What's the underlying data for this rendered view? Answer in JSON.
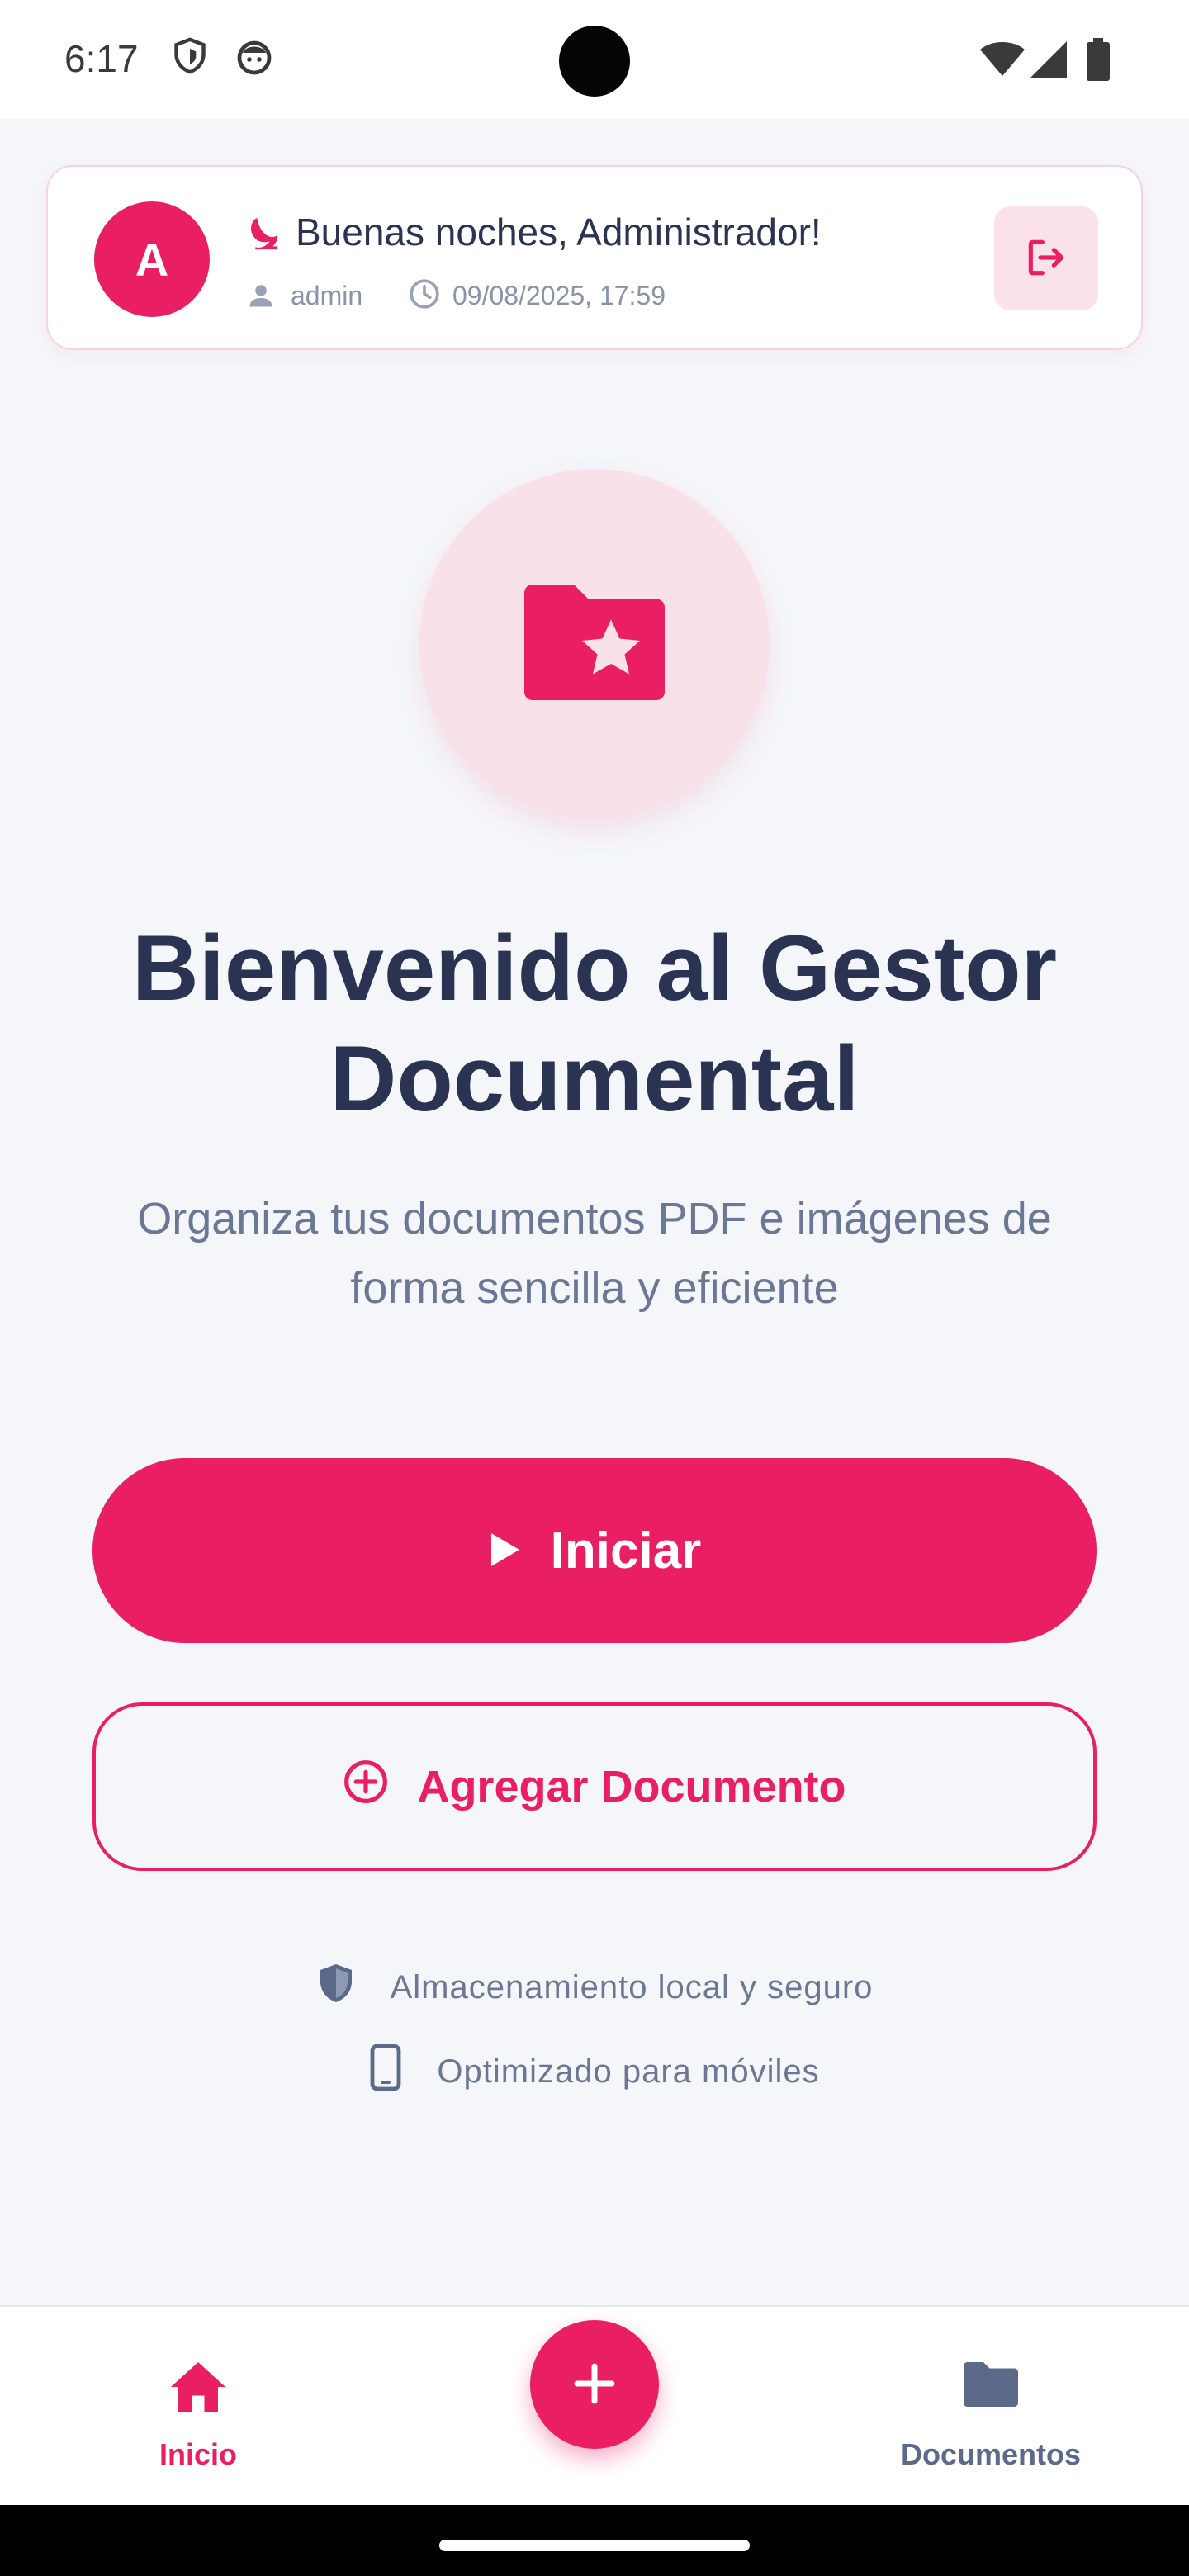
{
  "status_bar": {
    "time": "6:17",
    "icons": [
      "shield-icon",
      "robot-icon",
      "wifi-icon",
      "cellular-icon",
      "battery-icon"
    ]
  },
  "header": {
    "avatar_initial": "A",
    "greeting": "Buenas noches, Administrador!",
    "greeting_icon": "moon-icon",
    "username": "admin",
    "datetime": "09/08/2025, 17:59",
    "logout_icon": "logout-icon"
  },
  "hero": {
    "icon": "folder-star-icon",
    "title": "Bienvenido al Gestor Documental",
    "subtitle": "Organiza tus documentos PDF e imágenes de forma sencilla y eficiente"
  },
  "actions": {
    "start_label": "Iniciar",
    "add_document_label": "Agregar Documento"
  },
  "features": [
    {
      "icon": "shield-icon",
      "label": "Almacenamiento local y seguro"
    },
    {
      "icon": "mobile-icon",
      "label": "Optimizado para móviles"
    }
  ],
  "bottom_nav": {
    "items": [
      {
        "label": "Inicio",
        "icon": "home-icon",
        "active": true
      },
      {
        "label": "Documentos",
        "icon": "folder-icon",
        "active": false
      }
    ],
    "fab_icon": "plus-icon"
  },
  "colors": {
    "accent": "#E91E63",
    "accent_soft": "#F8E1E9",
    "text_dark": "#2A3452",
    "text_muted": "#6B7895",
    "background": "#F5F6FA",
    "nav_inactive": "#5C6A8A"
  }
}
